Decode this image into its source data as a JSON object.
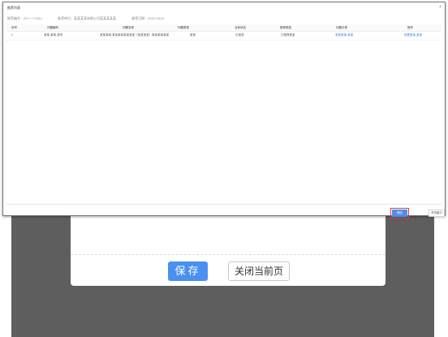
{
  "background": {
    "buttons": {
      "save": "保存",
      "close_page": "关闭当前页"
    }
  },
  "dialog": {
    "title": "推荐列表",
    "close": "×",
    "info": [
      "推荐编号：20++++70AJ",
      "推荐单位：某某某某有限公司某某某某某",
      "推荐日期：2021-09-01"
    ],
    "table": {
      "headers": [
        "序号",
        "问题编号",
        "问题名称",
        "问题类型",
        "当前状态",
        "推荐类型",
        "问题分类",
        "操作"
      ],
      "rows": [
        [
          "1",
          "某某-某某-某号",
          "某某某某-某某某某某某某某（某某某某）某某某某某某",
          "某某",
          "已接收",
          "已推荐某某",
          "某某某某-某某",
          "查看某某-某某"
        ]
      ]
    },
    "buttons": {
      "confirm": "确定",
      "cancel": "关闭窗口"
    }
  },
  "colors": {
    "primary": "#4a90f0",
    "highlight": "#e23b3b"
  }
}
